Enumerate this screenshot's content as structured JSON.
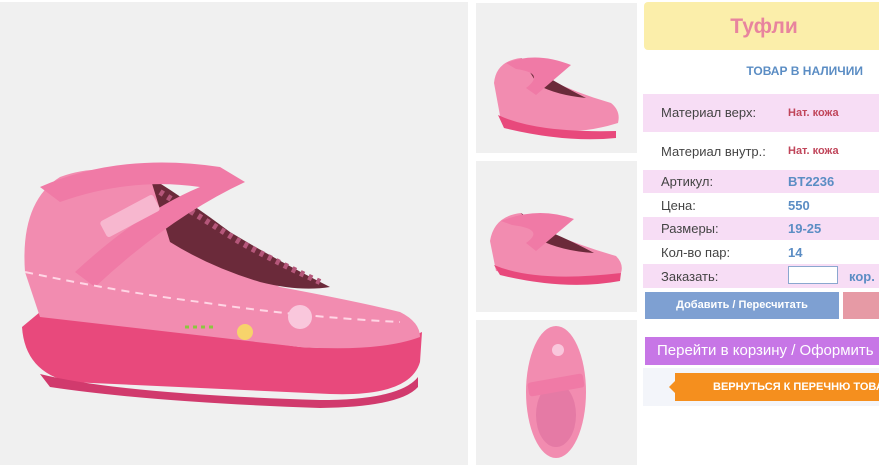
{
  "product": {
    "title": "Туфли",
    "availability": "ТОВАР В НАЛИЧИИ",
    "specs": [
      {
        "label": "Материал верх:",
        "value": "Нат. кожа"
      },
      {
        "label": "Материал внутр.:",
        "value": "Нат. кожа"
      },
      {
        "label": "Артикул:",
        "value": "BT2236"
      },
      {
        "label": "Цена:",
        "value": "550"
      },
      {
        "label": "Размеры:",
        "value": "19-25"
      },
      {
        "label": "Кол-во пар:",
        "value": "14"
      }
    ],
    "order_label": "Заказать:",
    "order_value": "",
    "order_unit": "кор."
  },
  "buttons": {
    "add": "Добавить / Пересчитать",
    "cart": "Перейти в корзину / Оформить",
    "back": "ВЕРНУТЬСЯ К ПЕРЕЧНЮ ТОВАРОВ"
  },
  "colors": {
    "shoe_pink": "#e8497c",
    "shoe_light": "#f28cb0",
    "label_blue": "#5b8dc4",
    "title_pink": "#e8849e"
  }
}
